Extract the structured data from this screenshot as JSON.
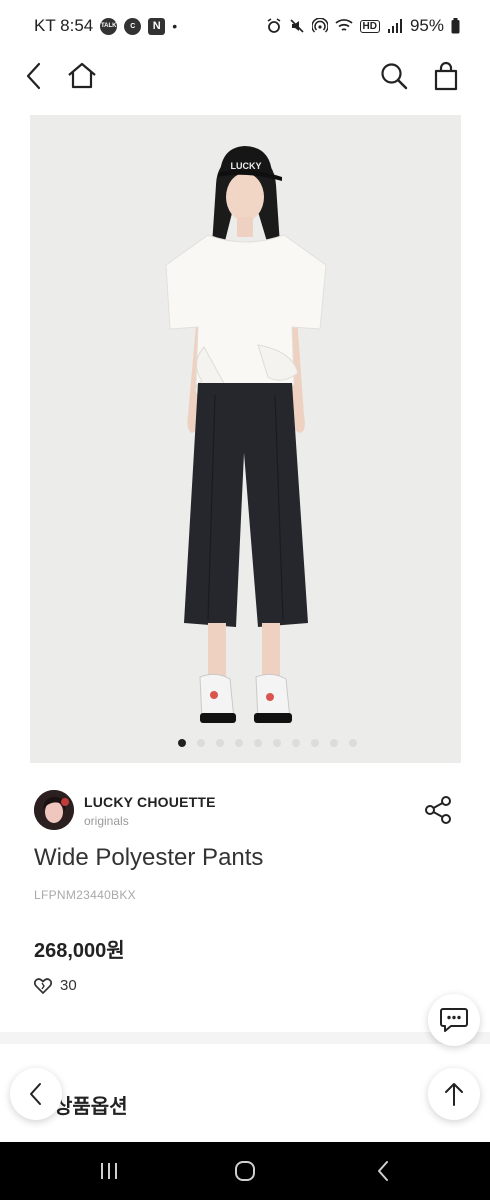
{
  "status_bar": {
    "carrier_time": "KT 8:54",
    "badge_talk": "TALK",
    "badge_c": "C",
    "badge_n": "N",
    "dot": "•",
    "hd": "HD",
    "battery": "95%"
  },
  "header": {
    "back_icon": "chevron-left-icon",
    "home_icon": "home-icon",
    "search_icon": "search-icon",
    "bag_icon": "shopping-bag-icon"
  },
  "gallery": {
    "image_description": "model wearing LUCKY cap, white top, black wide pants",
    "cap_text": "LUCKY",
    "dots_total": 10,
    "active_dot": 1
  },
  "brand": {
    "name": "LUCKY CHOUETTE",
    "subtitle": "originals"
  },
  "product": {
    "title": "Wide Polyester Pants",
    "code": "LFPNM23440BKX",
    "price": "268,000원",
    "likes": "30"
  },
  "section": {
    "title": "상품옵션"
  },
  "colors": {
    "accent": "#222222",
    "muted": "#9a9a9a",
    "image_bg": "#ececea"
  }
}
